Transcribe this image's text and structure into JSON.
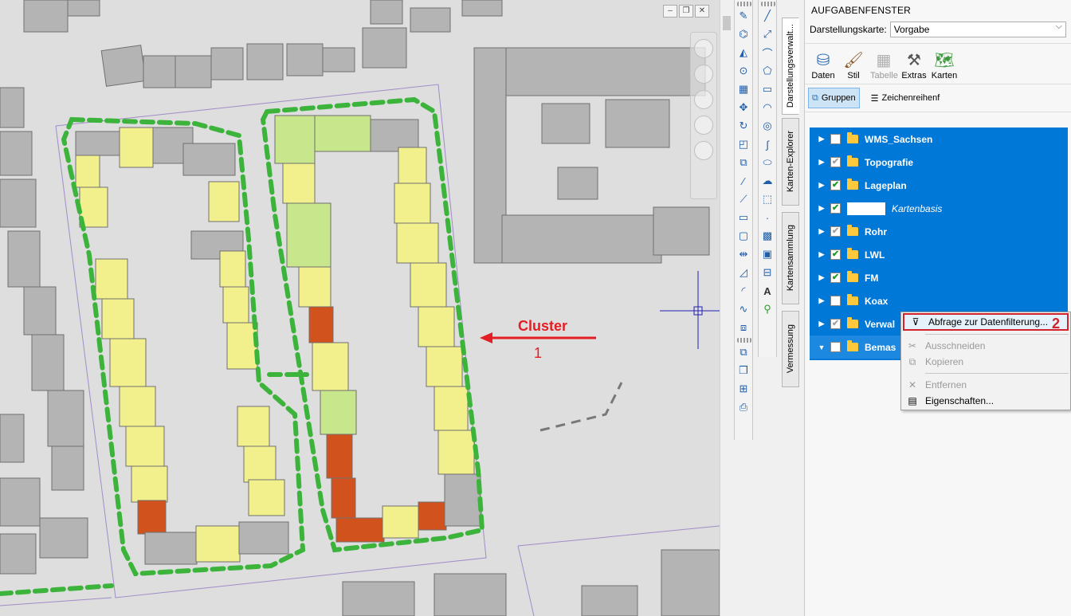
{
  "map": {
    "callout_label": "Cluster",
    "callout_number": "1",
    "colors": {
      "background": "#dedede",
      "building_grey": "#b4b4b4",
      "building_yellow": "#f2f08c",
      "building_light_green": "#c8e68c",
      "building_orange": "#d2521e",
      "cluster_outline": "#3cb43c",
      "annotation_red": "#e31e24",
      "crosshair": "#1e1eb4"
    }
  },
  "map_window_controls": [
    "minimize-icon",
    "restore-icon",
    "close-icon"
  ],
  "left_toolbar_icons": [
    "brush-icon",
    "polygon-edit-icon",
    "mirror-icon",
    "point-circle-icon",
    "rectangle-grid-icon",
    "move-icon",
    "rotate-icon",
    "scale-icon",
    "copy-icon",
    "trim-icon",
    "extend-icon",
    "break-icon",
    "join-icon",
    "offset-icon",
    "corner-icon",
    "arc-icon",
    "curve-icon",
    "layers-icon",
    "group-icon",
    "ungroup-icon",
    "text-frame-icon",
    "print-icon"
  ],
  "right_toolbar_icons": [
    "line-icon",
    "polyline-icon",
    "spline-icon",
    "polygon-icon",
    "rectangle-icon",
    "arc-icon",
    "circle-icon",
    "curve-icon",
    "ellipse-icon",
    "cloud-icon",
    "select-icon",
    "dimension-icon",
    "hatch-icon",
    "region-icon",
    "table-icon",
    "text-icon",
    "attribute-icon"
  ],
  "vertical_tabs": [
    "Darstellungsverwalt...",
    "Karten-Explorer",
    "Kartensammlung",
    "Vermessung"
  ],
  "taskpane": {
    "title": "AUFGABENFENSTER",
    "display_map_label": "Darstellungskarte:",
    "display_map_value": "Vorgabe",
    "ribbon": [
      {
        "label": "Daten",
        "icon": "database-icon",
        "disabled": false
      },
      {
        "label": "Stil",
        "icon": "brush-icon",
        "disabled": false
      },
      {
        "label": "Tabelle",
        "icon": "table-icon",
        "disabled": true
      },
      {
        "label": "Extras",
        "icon": "tools-icon",
        "disabled": false
      },
      {
        "label": "Karten",
        "icon": "map-icon",
        "disabled": false
      }
    ],
    "groups_button": "Gruppen",
    "draw_order_button": "Zeichenreihenf",
    "layers": [
      {
        "name": "WMS_Sachsen",
        "checked": "none",
        "expanded": false,
        "type": "folder"
      },
      {
        "name": "Topografie",
        "checked": "grey",
        "expanded": false,
        "type": "folder"
      },
      {
        "name": "Lageplan",
        "checked": "green",
        "expanded": false,
        "type": "folder"
      },
      {
        "name": "Kartenbasis",
        "checked": "green",
        "expanded": false,
        "type": "base"
      },
      {
        "name": "Rohr",
        "checked": "grey",
        "expanded": false,
        "type": "folder"
      },
      {
        "name": "LWL",
        "checked": "green",
        "expanded": false,
        "type": "folder"
      },
      {
        "name": "FM",
        "checked": "green",
        "expanded": false,
        "type": "folder"
      },
      {
        "name": "Koax",
        "checked": "none",
        "expanded": false,
        "type": "folder"
      },
      {
        "name": "Verwal",
        "checked": "grey",
        "expanded": false,
        "type": "folder"
      },
      {
        "name": "Bemas",
        "checked": "none",
        "expanded": true,
        "type": "folder"
      }
    ]
  },
  "context_menu": {
    "items": [
      {
        "label": "Abfrage zur Datenfilterung...",
        "icon": "filter-icon",
        "disabled": false,
        "highlighted": true
      },
      {
        "label": "Ausschneiden",
        "icon": "cut-icon",
        "disabled": true
      },
      {
        "label": "Kopieren",
        "icon": "copy-icon",
        "disabled": true
      },
      {
        "label": "Entfernen",
        "icon": "remove-icon",
        "disabled": true
      },
      {
        "label": "Eigenschaften...",
        "icon": "properties-icon",
        "disabled": false
      }
    ],
    "callout_number": "2"
  }
}
